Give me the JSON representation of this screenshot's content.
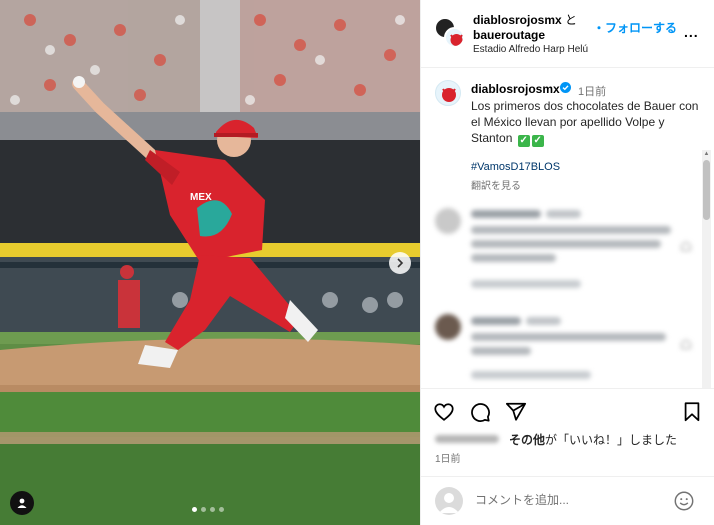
{
  "header": {
    "user1": "diablosrojosmx",
    "connector": "と",
    "user2": "baueroutage",
    "location": "Estadio Alfredo Harp Helú",
    "follow_label": "・フォローする",
    "more_label": "..."
  },
  "caption": {
    "username": "diablosrojosmx",
    "time": "1日前",
    "text": "Los primeros dos chocolates de Bauer con el México llevan por apellido Volpe y Stanton",
    "hashtag": "#VamosD17BLOS",
    "translate_label": "翻訳を見る"
  },
  "post_actions": {
    "likes_prefix_bold": "その他",
    "likes_suffix": "が「いいね！」しました",
    "date": "1日前"
  },
  "comment": {
    "placeholder": "コメントを追加..."
  },
  "carousel": {
    "slide_count": 4,
    "active_slide": 1
  },
  "colors": {
    "follow_blue": "#0095f6",
    "hashtag_blue": "#00376b",
    "jersey_red": "#d9232d",
    "verified_blue": "#0095f6"
  },
  "icons": {
    "like": "heart-icon",
    "comment": "speech-bubble-icon",
    "share": "paper-plane-icon",
    "save": "bookmark-icon",
    "emoji": "smiley-icon",
    "next": "chevron-right-icon",
    "tags": "person-tag-icon"
  }
}
